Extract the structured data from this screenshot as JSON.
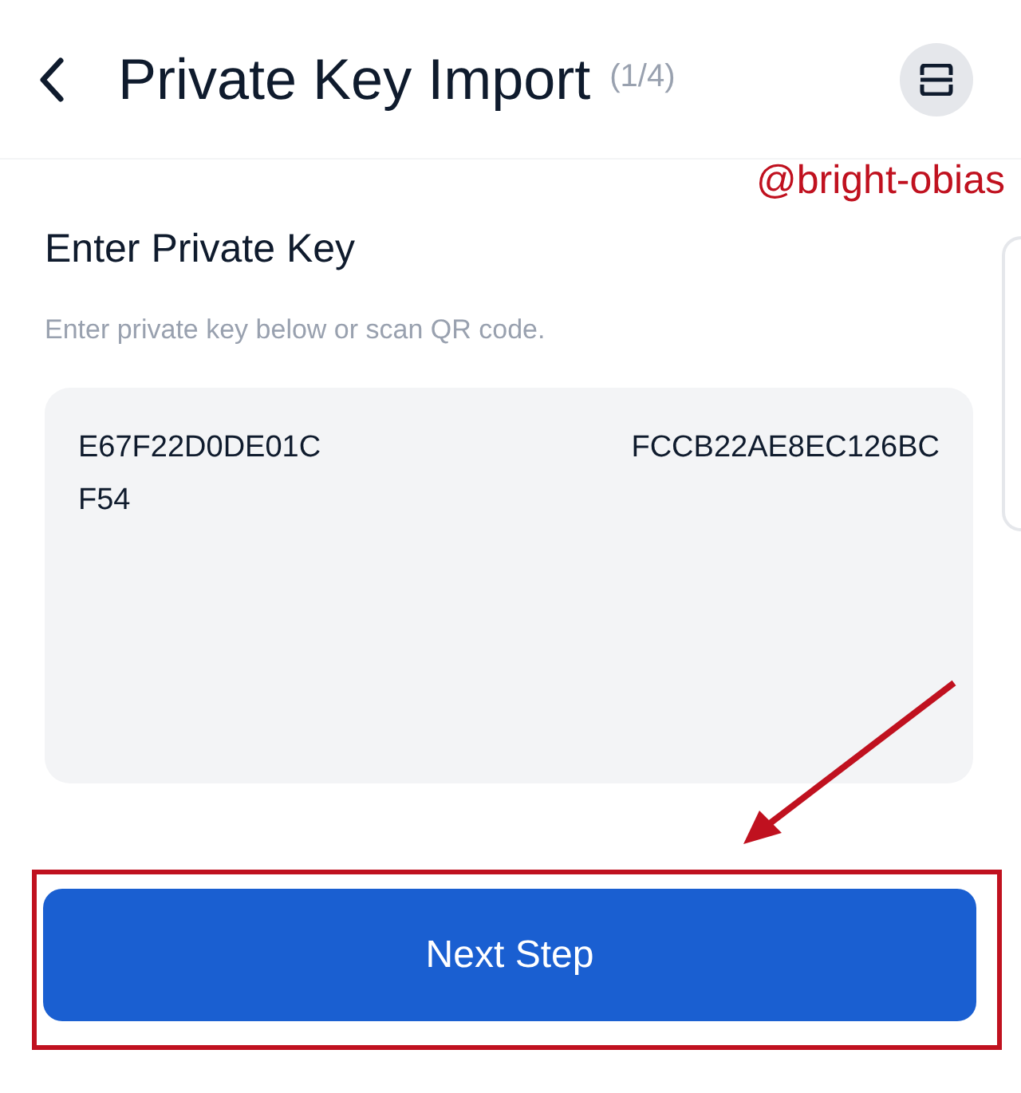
{
  "header": {
    "title": "Private Key Import",
    "step": "(1/4)"
  },
  "annotation": {
    "handle": "@bright-obias"
  },
  "section": {
    "heading": "Enter Private Key",
    "hint": "Enter private key below or scan QR code."
  },
  "key_field": {
    "segments": [
      {
        "text": "E67F22D0DE01C",
        "kind": "left"
      },
      {
        "text": "FCCB22AE8EC126BC",
        "kind": "right"
      },
      {
        "text": "F54",
        "kind": "left"
      }
    ]
  },
  "buttons": [
    "Next Step"
  ]
}
